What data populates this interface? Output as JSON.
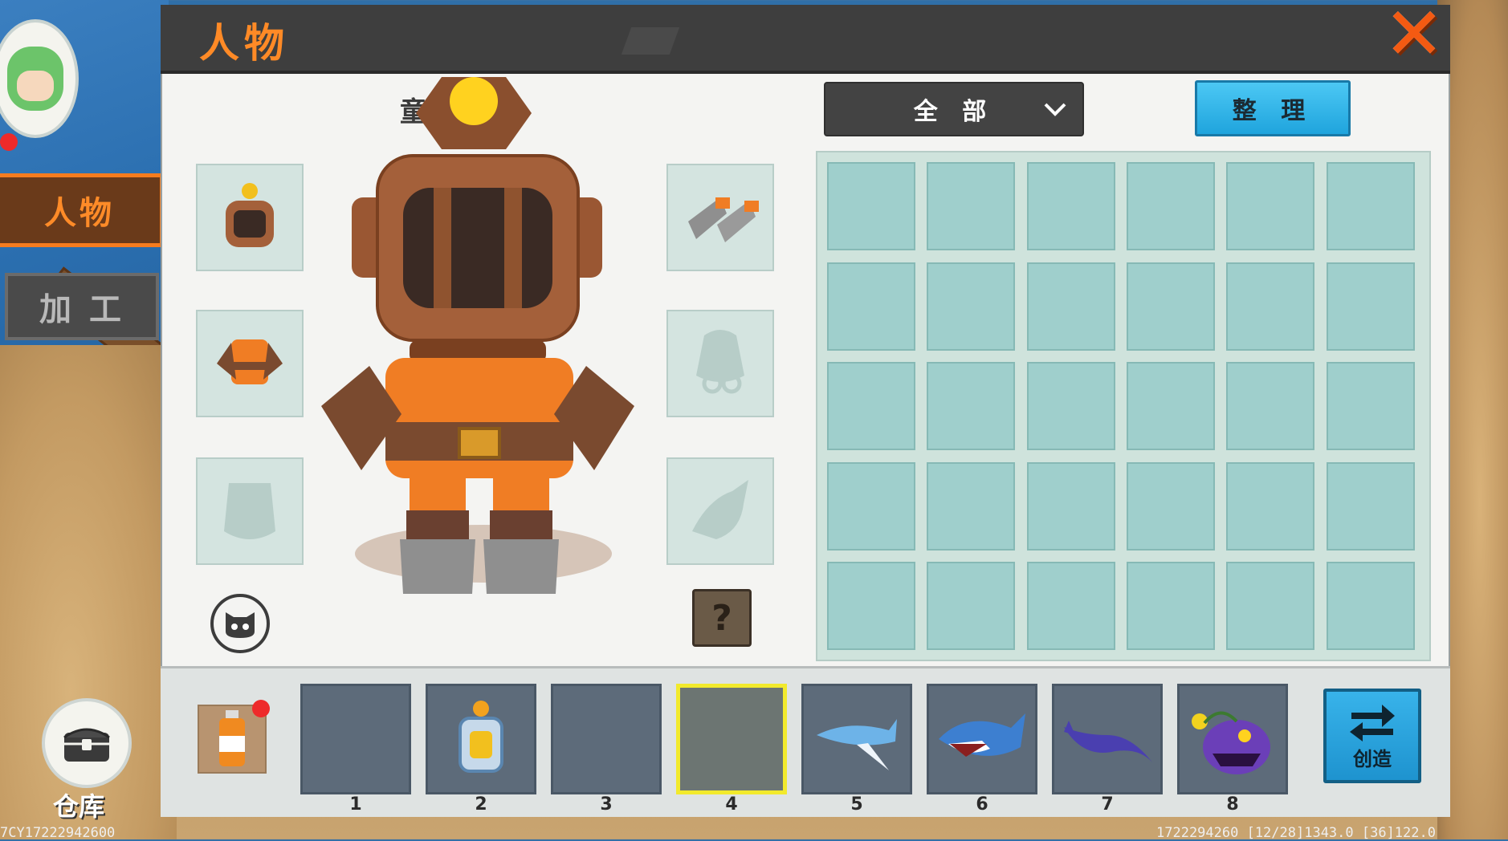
{
  "header": {
    "title": "人物",
    "close_icon": "close-x-icon"
  },
  "sidebar": {
    "tabs": [
      {
        "label": "人物",
        "active": true
      },
      {
        "label": "加 工",
        "active": false
      }
    ],
    "warehouse_label": "仓库"
  },
  "character": {
    "name_partial": "童"
  },
  "equipment": {
    "left": [
      "diving-helmet-icon",
      "diving-suit-icon",
      "cape-silhouette-icon"
    ],
    "right": [
      "flippers-icon",
      "accessory-silhouette-icon",
      "mount-silhouette-icon"
    ],
    "help_label": "?"
  },
  "inventory": {
    "filter_value": "全 部",
    "sort_label": "整 理",
    "rows": 5,
    "cols": 6
  },
  "hotbar": {
    "slots": [
      {
        "number": "1",
        "item": ""
      },
      {
        "number": "2",
        "item": "lantern-icon"
      },
      {
        "number": "3",
        "item": ""
      },
      {
        "number": "4",
        "item": "",
        "selected": true
      },
      {
        "number": "5",
        "item": "swordfish-icon"
      },
      {
        "number": "6",
        "item": "shark-icon"
      },
      {
        "number": "7",
        "item": "manta-ray-icon"
      },
      {
        "number": "8",
        "item": "anglerfish-icon"
      }
    ],
    "create_label": "创造"
  },
  "debug": {
    "left_text": "7CY17222942600",
    "right_text": "1722294260    [12/28]1343.0    [36]122.0"
  },
  "colors": {
    "accent_orange": "#ff8a26",
    "selected_yellow": "#f2ea2c",
    "button_blue": "#1fa4dd"
  }
}
